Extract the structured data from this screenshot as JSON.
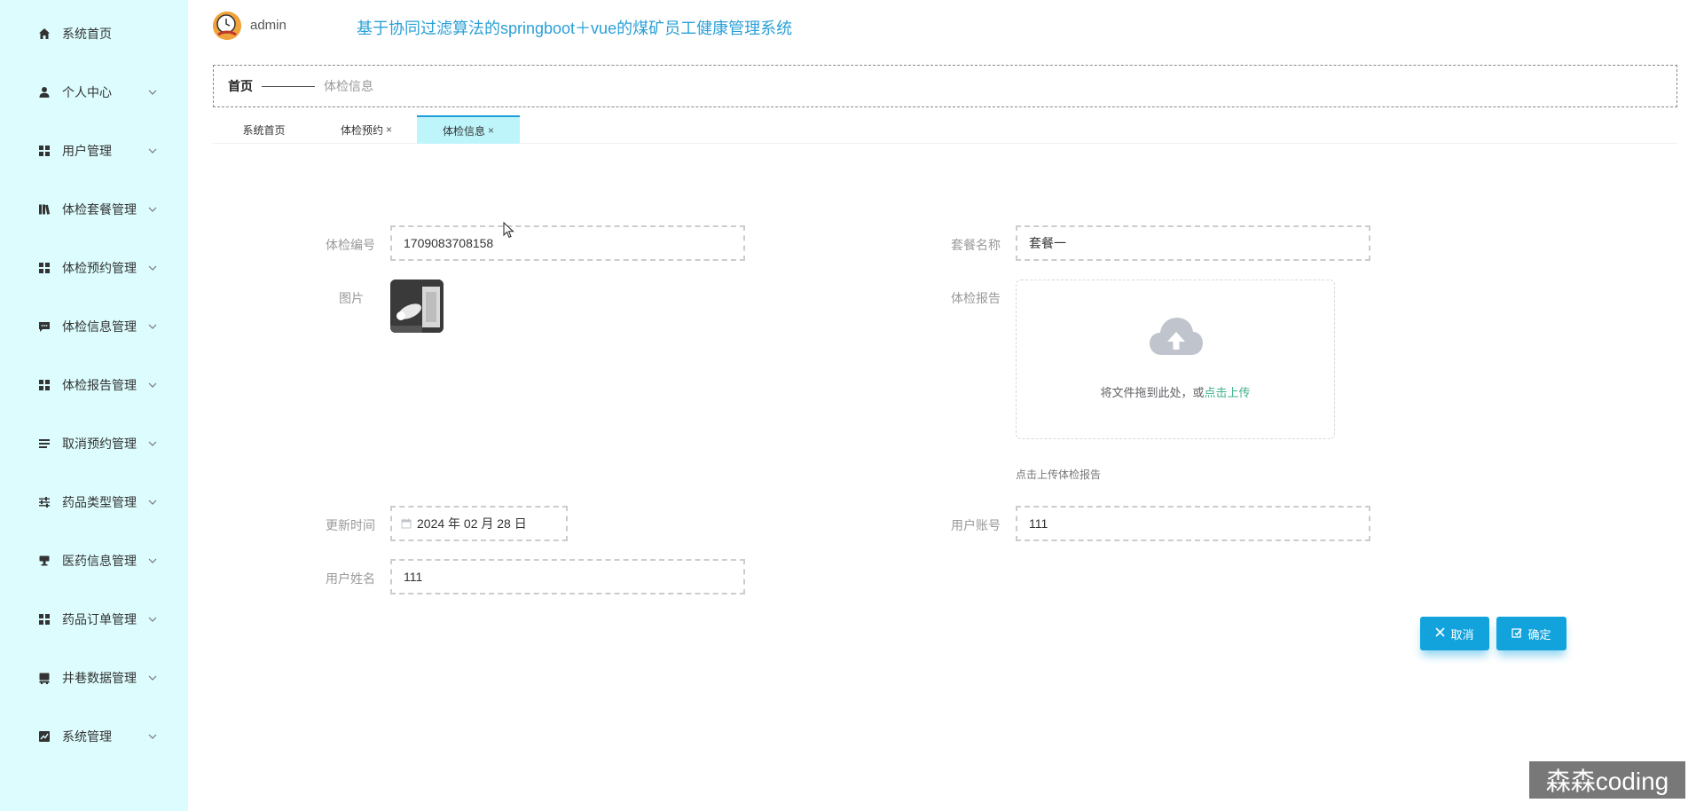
{
  "sidebar": {
    "items": [
      {
        "label": "系统首页",
        "icon": "home-icon"
      },
      {
        "label": "个人中心",
        "icon": "user-icon"
      },
      {
        "label": "用户管理",
        "icon": "grid-icon"
      },
      {
        "label": "体检套餐管理",
        "icon": "book-icon"
      },
      {
        "label": "体检预约管理",
        "icon": "grid-icon"
      },
      {
        "label": "体检信息管理",
        "icon": "chat-icon"
      },
      {
        "label": "体检报告管理",
        "icon": "grid-icon"
      },
      {
        "label": "取消预约管理",
        "icon": "list-icon"
      },
      {
        "label": "药品类型管理",
        "icon": "sliders-icon"
      },
      {
        "label": "医药信息管理",
        "icon": "pill-icon"
      },
      {
        "label": "药品订单管理",
        "icon": "grid-icon"
      },
      {
        "label": "井巷数据管理",
        "icon": "database-icon"
      },
      {
        "label": "系统管理",
        "icon": "chart-icon"
      }
    ]
  },
  "header": {
    "username": "admin",
    "title": "基于协同过滤算法的springboot＋vue的煤矿员工健康管理系统"
  },
  "breadcrumb": {
    "home": "首页",
    "current": "体检信息"
  },
  "tabs": [
    {
      "label": "系统首页",
      "closable": false,
      "active": false
    },
    {
      "label": "体检预约",
      "closable": true,
      "active": false
    },
    {
      "label": "体检信息",
      "closable": true,
      "active": true
    }
  ],
  "tab_close_symbol": "×",
  "form": {
    "exam_no_label": "体检编号",
    "exam_no_value": "1709083708158",
    "package_label": "套餐名称",
    "package_value": "套餐一",
    "image_label": "图片",
    "report_label": "体检报告",
    "upload_text": "将文件拖到此处，或",
    "upload_link": "点击上传",
    "upload_tip": "点击上传体检报告",
    "update_time_label": "更新时间",
    "update_time_value": "2024 年 02 月 28 日",
    "account_label": "用户账号",
    "account_value": "111",
    "name_label": "用户姓名",
    "name_value": "111"
  },
  "buttons": {
    "cancel": "取消",
    "confirm": "确定"
  },
  "watermark": "森森coding",
  "colors": {
    "sidebar_bg": "#dcfcfd",
    "accent": "#12a3dd",
    "title": "#2ba0d8",
    "active_tab": "#bdf5fb",
    "link": "#3fb28f"
  }
}
